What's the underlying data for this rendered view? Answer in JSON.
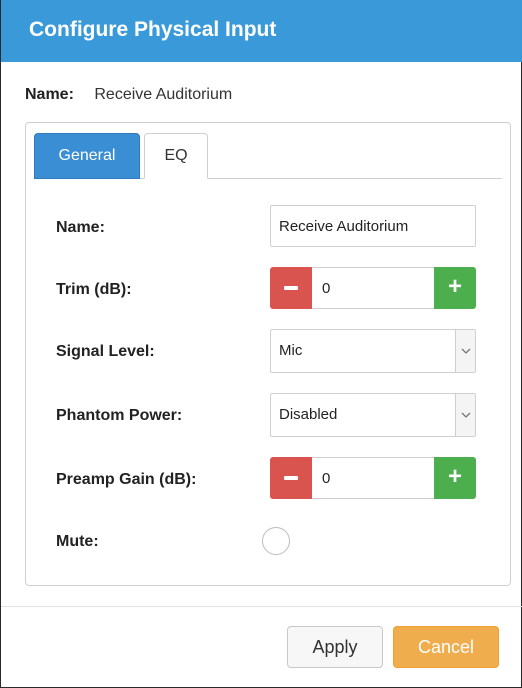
{
  "dialog": {
    "title": "Configure Physical Input"
  },
  "summary": {
    "name_label": "Name:",
    "name_value": "Receive Auditorium"
  },
  "tabs": [
    {
      "label": "General",
      "active": true
    },
    {
      "label": "EQ",
      "active": false
    }
  ],
  "form": {
    "name": {
      "label": "Name:",
      "value": "Receive Auditorium"
    },
    "trim": {
      "label": "Trim (dB):",
      "value": "0"
    },
    "signal_level": {
      "label": "Signal Level:",
      "value": "Mic"
    },
    "phantom_power": {
      "label": "Phantom Power:",
      "value": "Disabled"
    },
    "preamp_gain": {
      "label": "Preamp Gain (dB):",
      "value": "0"
    },
    "mute": {
      "label": "Mute:",
      "checked": false
    }
  },
  "footer": {
    "apply_label": "Apply",
    "cancel_label": "Cancel"
  },
  "icons": {
    "minus": "minus-icon",
    "plus": "plus-icon",
    "dropdown": "chevron-down-icon"
  },
  "colors": {
    "titlebar": "#3a9ad9",
    "tab_active": "#3a8ed3",
    "decrement": "#d9534f",
    "increment": "#4cae4c",
    "cancel": "#f0ad4e"
  }
}
